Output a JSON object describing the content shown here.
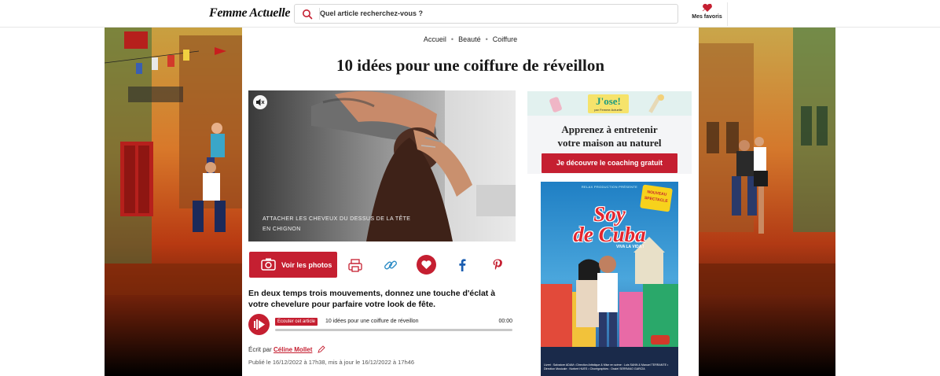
{
  "header": {
    "logo": "Femme Actuelle",
    "search_placeholder": "Quel article recherchez-vous ?",
    "favorites_label": "Mes favoris",
    "accent_color": "#c51f31"
  },
  "breadcrumb": [
    "Accueil",
    "Beauté",
    "Coiffure"
  ],
  "article": {
    "title": "10 idées pour une coiffure de réveillon",
    "image_caption_line1": "Attacher les cheveux du dessus de la tête",
    "image_caption_line2": "en chignon",
    "photos_button": "Voir les photos",
    "share_icons": [
      "print-icon",
      "link-icon",
      "heart-icon",
      "facebook-icon",
      "pinterest-icon"
    ],
    "intro": "En deux temps trois mouvements, donnez une touche d'éclat à votre chevelure pour parfaire votre look de fête.",
    "audio": {
      "badge": "Ecouter cet article",
      "title": "10 idées pour une coiffure de réveillon",
      "time": "00:00",
      "progress": 0
    },
    "byline_prefix": "Écrit par",
    "author": "Céline Mollet",
    "published": "Publié le 16/12/2022 à 17h38, mis à jour le 16/12/2022 à 17h46"
  },
  "ad_jose": {
    "logo": "J'ose!",
    "logo_sub": "par Femme Actuelle",
    "line1": "Apprenez à entretenir",
    "line2": "votre maison au naturel",
    "button": "Je découvre le coaching gratuit"
  },
  "ad_poster": {
    "top_text": "RELAX PRODUCTION PRÉSENTE",
    "brand_line1": "Soy",
    "brand_line2": "de Cuba",
    "subtitle": "VIVA LA VIDA !",
    "badge_line1": "NOUVEAU",
    "badge_line2": "SPECTACLE",
    "credits": "Livret : Salvatore ADAM • Direction Artistique & Mise en scène : Luis SANN & Manuel TERRANTE • Direction Musicale : Norbert HUES • Chorégraphies : Ossiel SERRANO GARCÍA"
  }
}
